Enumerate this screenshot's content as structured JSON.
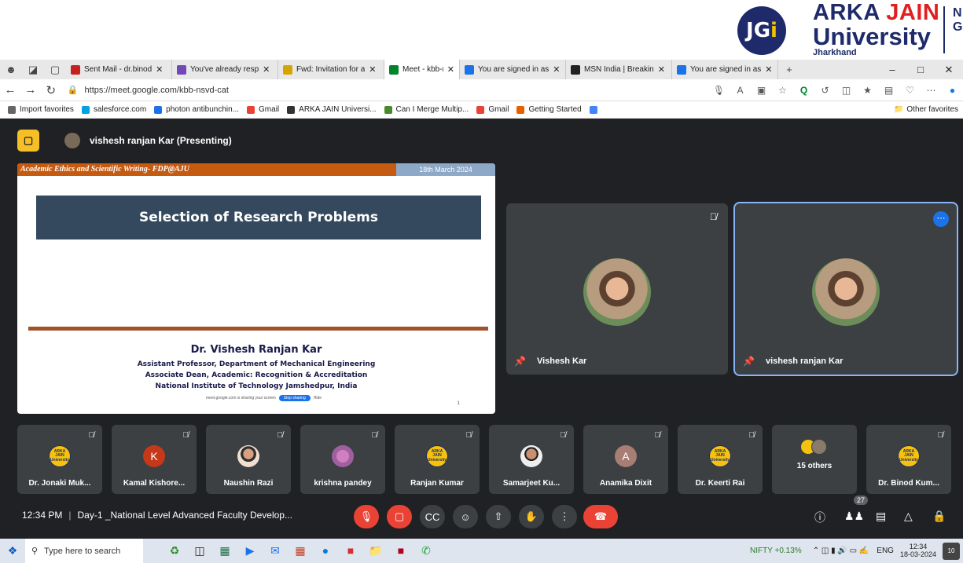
{
  "logo": {
    "jgi_prefix": "JG",
    "jgi_i": "i",
    "line1_a": "ARKA ",
    "line1_b": "JAIN",
    "line2": "University",
    "line3": "Jharkhand",
    "partial": "N G"
  },
  "tabs": [
    {
      "label": "Sent Mail - dr.binod",
      "color": "#c5221f"
    },
    {
      "label": "You've already resp",
      "color": "#7248b9"
    },
    {
      "label": "Fwd: Invitation for a",
      "color": "#d6a400"
    },
    {
      "label": "Meet - kbb-ns",
      "color": "#00832d",
      "active": true
    },
    {
      "label": "You are signed in as",
      "color": "#1a73e8"
    },
    {
      "label": "MSN India | Breakin",
      "color": "#222222"
    },
    {
      "label": "You are signed in as",
      "color": "#1a73e8"
    }
  ],
  "address": {
    "url": "https://meet.google.com/kbb-nsvd-cat"
  },
  "favorites": [
    {
      "label": "Import favorites",
      "color": "#666666"
    },
    {
      "label": "salesforce.com",
      "color": "#00a1e0"
    },
    {
      "label": "photon antibunchin...",
      "color": "#1a73e8"
    },
    {
      "label": "Gmail",
      "color": "#ea4335"
    },
    {
      "label": "ARKA JAIN Universi...",
      "color": "#333333"
    },
    {
      "label": "Can I Merge Multip...",
      "color": "#4a8a2a"
    },
    {
      "label": "Gmail",
      "color": "#ea4335"
    },
    {
      "label": "Getting Started",
      "color": "#e66000"
    },
    {
      "label": "",
      "color": "#4285f4"
    }
  ],
  "other_favorites": "Other favorites",
  "presenting": "vishesh ranjan Kar (Presenting)",
  "slide": {
    "header_left": "Academic Ethics and Scientific Writing- FDP@AJU",
    "header_right": "18th March 2024",
    "title": "Selection of Research Problems",
    "name": "Dr. Vishesh Ranjan Kar",
    "line1": "Assistant Professor, Department of Mechanical Engineering",
    "line2": "Associate Dean, Academic: Recognition & Accreditation",
    "line3": "National Institute of Technology Jamshedpur, India",
    "share_text": "meet.google.com is sharing your screen",
    "stop_sharing": "Stop sharing",
    "hide": "Hide",
    "page": "1"
  },
  "big_tiles": [
    {
      "name": "Vishesh Kar"
    },
    {
      "name": "vishesh ranjan Kar"
    }
  ],
  "participants": [
    {
      "name": "Dr. Jonaki Muk...",
      "avatar": "ajy"
    },
    {
      "name": "Kamal Kishore...",
      "avatar": "k",
      "initial": "K"
    },
    {
      "name": "Naushin Razi",
      "avatar": "photo1"
    },
    {
      "name": "krishna pandey",
      "avatar": "photo2"
    },
    {
      "name": "Ranjan Kumar",
      "avatar": "ajy"
    },
    {
      "name": "Samarjeet Ku...",
      "avatar": "photo3"
    },
    {
      "name": "Anamika Dixit",
      "avatar": "a",
      "initial": "A"
    },
    {
      "name": "Dr. Keerti Rai",
      "avatar": "ajy"
    },
    {
      "name": "15 others",
      "avatar": "others"
    },
    {
      "name": "Dr. Binod Kum...",
      "avatar": "ajy"
    }
  ],
  "ajy_logo_text": "ARKA JAIN University",
  "meeting": {
    "time": "12:34 PM",
    "title": "Day-1 _National Level Advanced Faculty Develop...",
    "people_count": "27"
  },
  "taskbar": {
    "search_placeholder": "Type here to search",
    "nifty": "NIFTY +0.13%",
    "lang": "ENG",
    "time": "12:34",
    "date": "18-03-2024",
    "notif_count": "10"
  }
}
